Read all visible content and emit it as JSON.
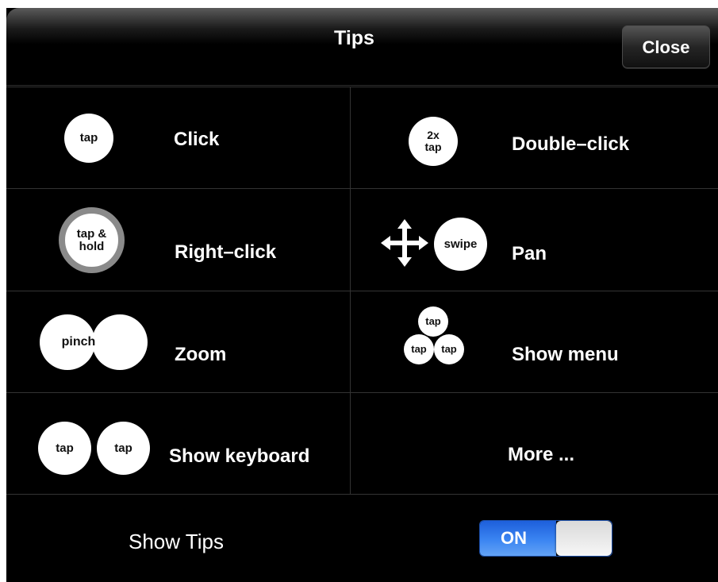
{
  "header": {
    "title": "Tips",
    "close_label": "Close"
  },
  "tips": [
    {
      "label": "Click",
      "icon_texts": [
        "tap"
      ]
    },
    {
      "label": "Double–click",
      "icon_texts": [
        "2x\ntap"
      ]
    },
    {
      "label": "Right–click",
      "icon_texts": [
        "tap &\nhold"
      ]
    },
    {
      "label": "Pan",
      "icon_texts": [
        "swipe"
      ],
      "icon": "four-way-arrow-icon"
    },
    {
      "label": "Zoom",
      "icon_texts": [
        "pinch"
      ]
    },
    {
      "label": "Show menu",
      "icon_texts": [
        "tap",
        "tap",
        "tap"
      ]
    },
    {
      "label": "Show keyboard",
      "icon_texts": [
        "tap",
        "tap"
      ]
    },
    {
      "label": "More ..."
    }
  ],
  "footer": {
    "show_tips_label": "Show Tips",
    "toggle_label": "ON",
    "toggle_state": "on",
    "toggle_color": "#3b85f2"
  }
}
